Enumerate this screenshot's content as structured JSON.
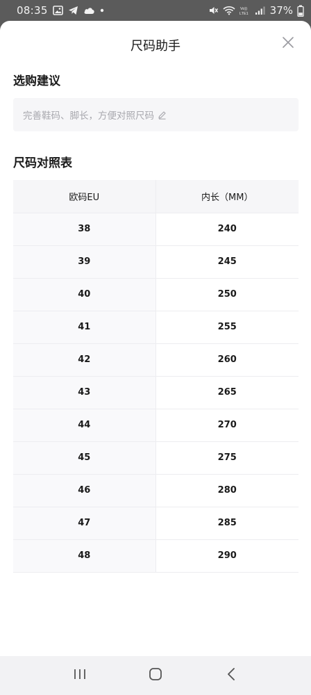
{
  "status_bar": {
    "time": "08:35",
    "battery": "37%",
    "left_icons": [
      "image-icon",
      "telegram-icon",
      "cloud-icon",
      "dot-icon"
    ],
    "right_icons": [
      "mute-icon",
      "wifi-icon",
      "volte-icon",
      "signal-icon"
    ]
  },
  "sheet": {
    "title": "尺码助手",
    "close_icon": "close-icon"
  },
  "advice": {
    "title": "选购建议",
    "placeholder": "完善鞋码、脚长，方便对照尺码",
    "edit_icon": "pencil-icon"
  },
  "size_chart": {
    "title": "尺码对照表",
    "headers": [
      "欧码EU",
      "内长（MM）"
    ],
    "rows": [
      [
        "38",
        "240"
      ],
      [
        "39",
        "245"
      ],
      [
        "40",
        "250"
      ],
      [
        "41",
        "255"
      ],
      [
        "42",
        "260"
      ],
      [
        "43",
        "265"
      ],
      [
        "44",
        "270"
      ],
      [
        "45",
        "275"
      ],
      [
        "46",
        "280"
      ],
      [
        "47",
        "285"
      ],
      [
        "48",
        "290"
      ]
    ]
  },
  "nav_bar": {
    "buttons": [
      "recent-apps-icon",
      "home-icon",
      "back-icon"
    ]
  }
}
